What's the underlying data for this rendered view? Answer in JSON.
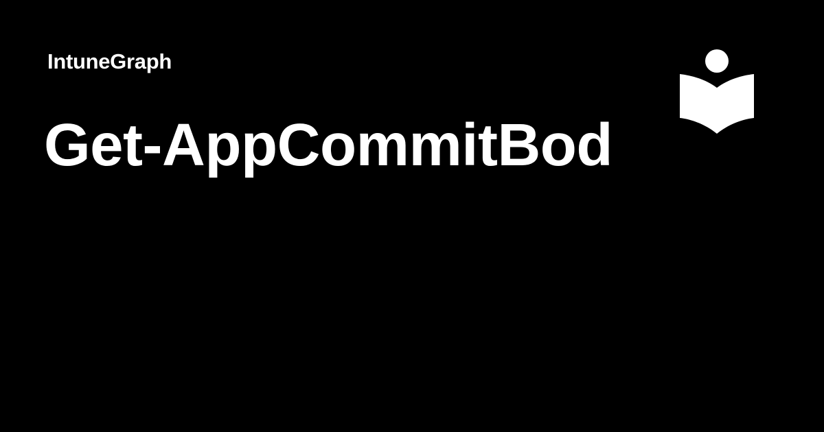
{
  "header": {
    "site_name": "IntuneGraph",
    "logo_icon": "reader-book-icon"
  },
  "main": {
    "title": "Get-AppCommitBod"
  },
  "colors": {
    "background": "#000000",
    "text": "#ffffff"
  }
}
